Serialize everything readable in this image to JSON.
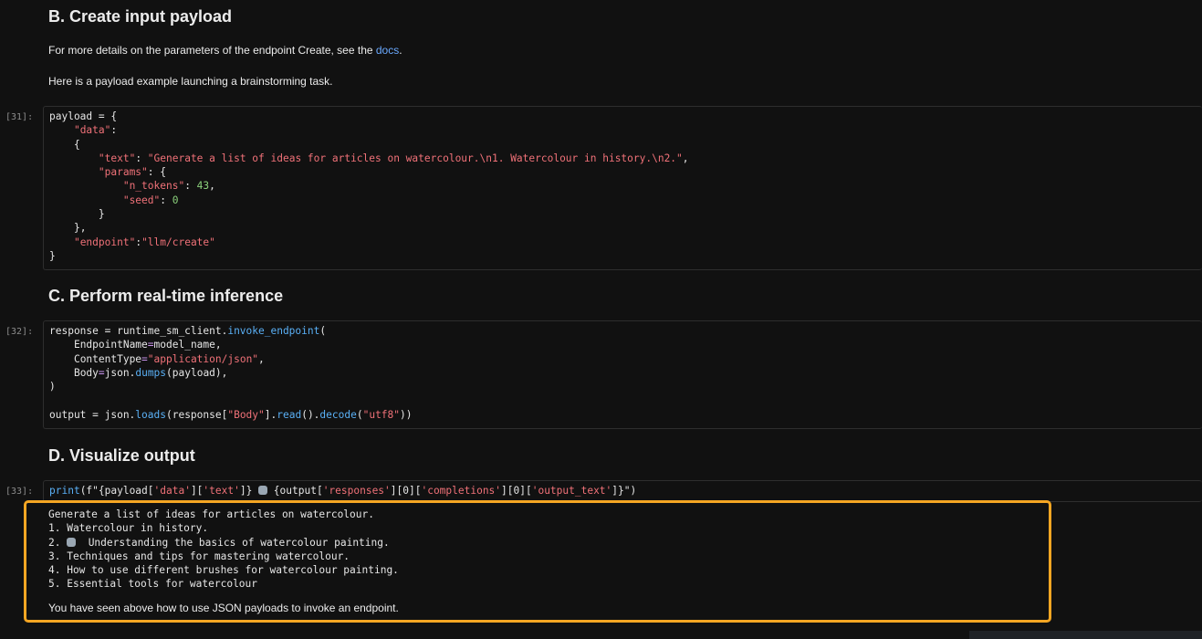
{
  "sections": {
    "b": {
      "heading": "B. Create input payload",
      "para1_prefix": "For more details on the parameters of the endpoint Create, see the ",
      "para1_link": "docs",
      "para1_suffix": ".",
      "para2": "Here is a payload example launching a brainstorming task."
    },
    "c": {
      "heading": "C. Perform real-time inference"
    },
    "d": {
      "heading": "D. Visualize output"
    }
  },
  "cells": {
    "c31": {
      "prompt": "[31]:",
      "code": {
        "l1a": "payload = {",
        "l2": "\"data\"",
        "l2b": ":",
        "l3": "{",
        "l4k": "\"text\"",
        "l4v": "\"Generate a list of ideas for articles on watercolour.\\n1. Watercolour in history.\\n2.\"",
        "l5k": "\"params\"",
        "l5v": ": {",
        "l6k": "\"n_tokens\"",
        "l6v": "43",
        "l7k": "\"seed\"",
        "l7v": "0",
        "l8": "}",
        "l9": "},",
        "l10k": "\"endpoint\"",
        "l10v": "\"llm/create\"",
        "l11": "}"
      }
    },
    "c32": {
      "prompt": "[32]:",
      "code": {
        "l1a": "response = runtime_sm_client.",
        "l1f": "invoke_endpoint",
        "l1b": "(",
        "l2a": "EndpointName",
        "l2b": "model_name,",
        "l3a": "ContentType",
        "l3s": "\"application/json\"",
        "l4a": "Body",
        "l4b": "json.",
        "l4f": "dumps",
        "l4c": "(payload),",
        "l5": ")",
        "l7a": "output = json.",
        "l7f": "loads",
        "l7b": "(response[",
        "l7s": "\"Body\"",
        "l7c": "].",
        "l7f2": "read",
        "l7d": "().",
        "l7f3": "decode",
        "l7e": "(",
        "l7s2": "\"utf8\"",
        "l7g": "))"
      }
    },
    "c33": {
      "prompt": "[33]:",
      "code": {
        "p1": "print",
        "p2": "(f\"{payload[",
        "s1": "'data'",
        "p3": "][",
        "s2": "'text'",
        "p4": "]} ",
        "p5": " {output[",
        "s3": "'responses'",
        "p6": "][0][",
        "s4": "'completions'",
        "p7": "][0][",
        "s5": "'output_text'",
        "p8": "]}\")"
      }
    }
  },
  "output": {
    "lines": [
      "Generate a list of ideas for articles on watercolour.",
      "1. Watercolour in history.",
      "2. ",
      "  Understanding the basics of watercolour painting.",
      "3. Techniques and tips for mastering watercolour.",
      "4. How to use different brushes for watercolour painting.",
      "5. Essential tools for watercolour"
    ],
    "note": "You have seen above how to use JSON payloads to invoke an endpoint."
  },
  "icons": {
    "robot": "robot-emoji-icon"
  }
}
